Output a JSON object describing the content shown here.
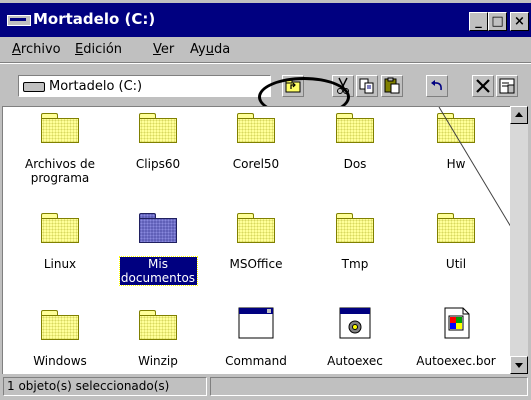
{
  "window": {
    "title": "Mortadelo (C:)"
  },
  "titlebar_buttons": {
    "minimize": "_",
    "maximize": "□",
    "close": "×"
  },
  "menu": [
    {
      "underline": "A",
      "rest": "rchivo"
    },
    {
      "underline": "E",
      "rest": "dición"
    },
    {
      "underline": "V",
      "rest": "er"
    },
    {
      "pre": "Ay",
      "underline": "u",
      "rest": "da"
    }
  ],
  "address": {
    "value": "Mortadelo (C:)"
  },
  "toolbar_icons": [
    "up-one-level-icon",
    "cut-icon",
    "copy-icon",
    "paste-icon",
    "undo-icon",
    "delete-icon",
    "properties-icon"
  ],
  "items": [
    {
      "label": "Archivos de programa",
      "type": "folder"
    },
    {
      "label": "Clips60",
      "type": "folder"
    },
    {
      "label": "Corel50",
      "type": "folder"
    },
    {
      "label": "Dos",
      "type": "folder"
    },
    {
      "label": "Hw",
      "type": "folder"
    },
    {
      "label": "Linux",
      "type": "folder"
    },
    {
      "label": "Mis documentos",
      "type": "folder-special",
      "selected": true
    },
    {
      "label": "MSOffice",
      "type": "folder"
    },
    {
      "label": "Tmp",
      "type": "folder"
    },
    {
      "label": "Util",
      "type": "folder"
    },
    {
      "label": "Windows",
      "type": "folder"
    },
    {
      "label": "Winzip",
      "type": "folder"
    },
    {
      "label": "Command",
      "type": "msdos-program"
    },
    {
      "label": "Autoexec",
      "type": "batch-file"
    },
    {
      "label": "Autoexec.bor",
      "type": "generic-file"
    }
  ],
  "status": {
    "text": "1 objeto(s) seleccionado(s)"
  },
  "colors": {
    "title_bar": "#000080",
    "face": "#c0c0c0",
    "folder": "#ffff99",
    "selection": "#000080"
  }
}
